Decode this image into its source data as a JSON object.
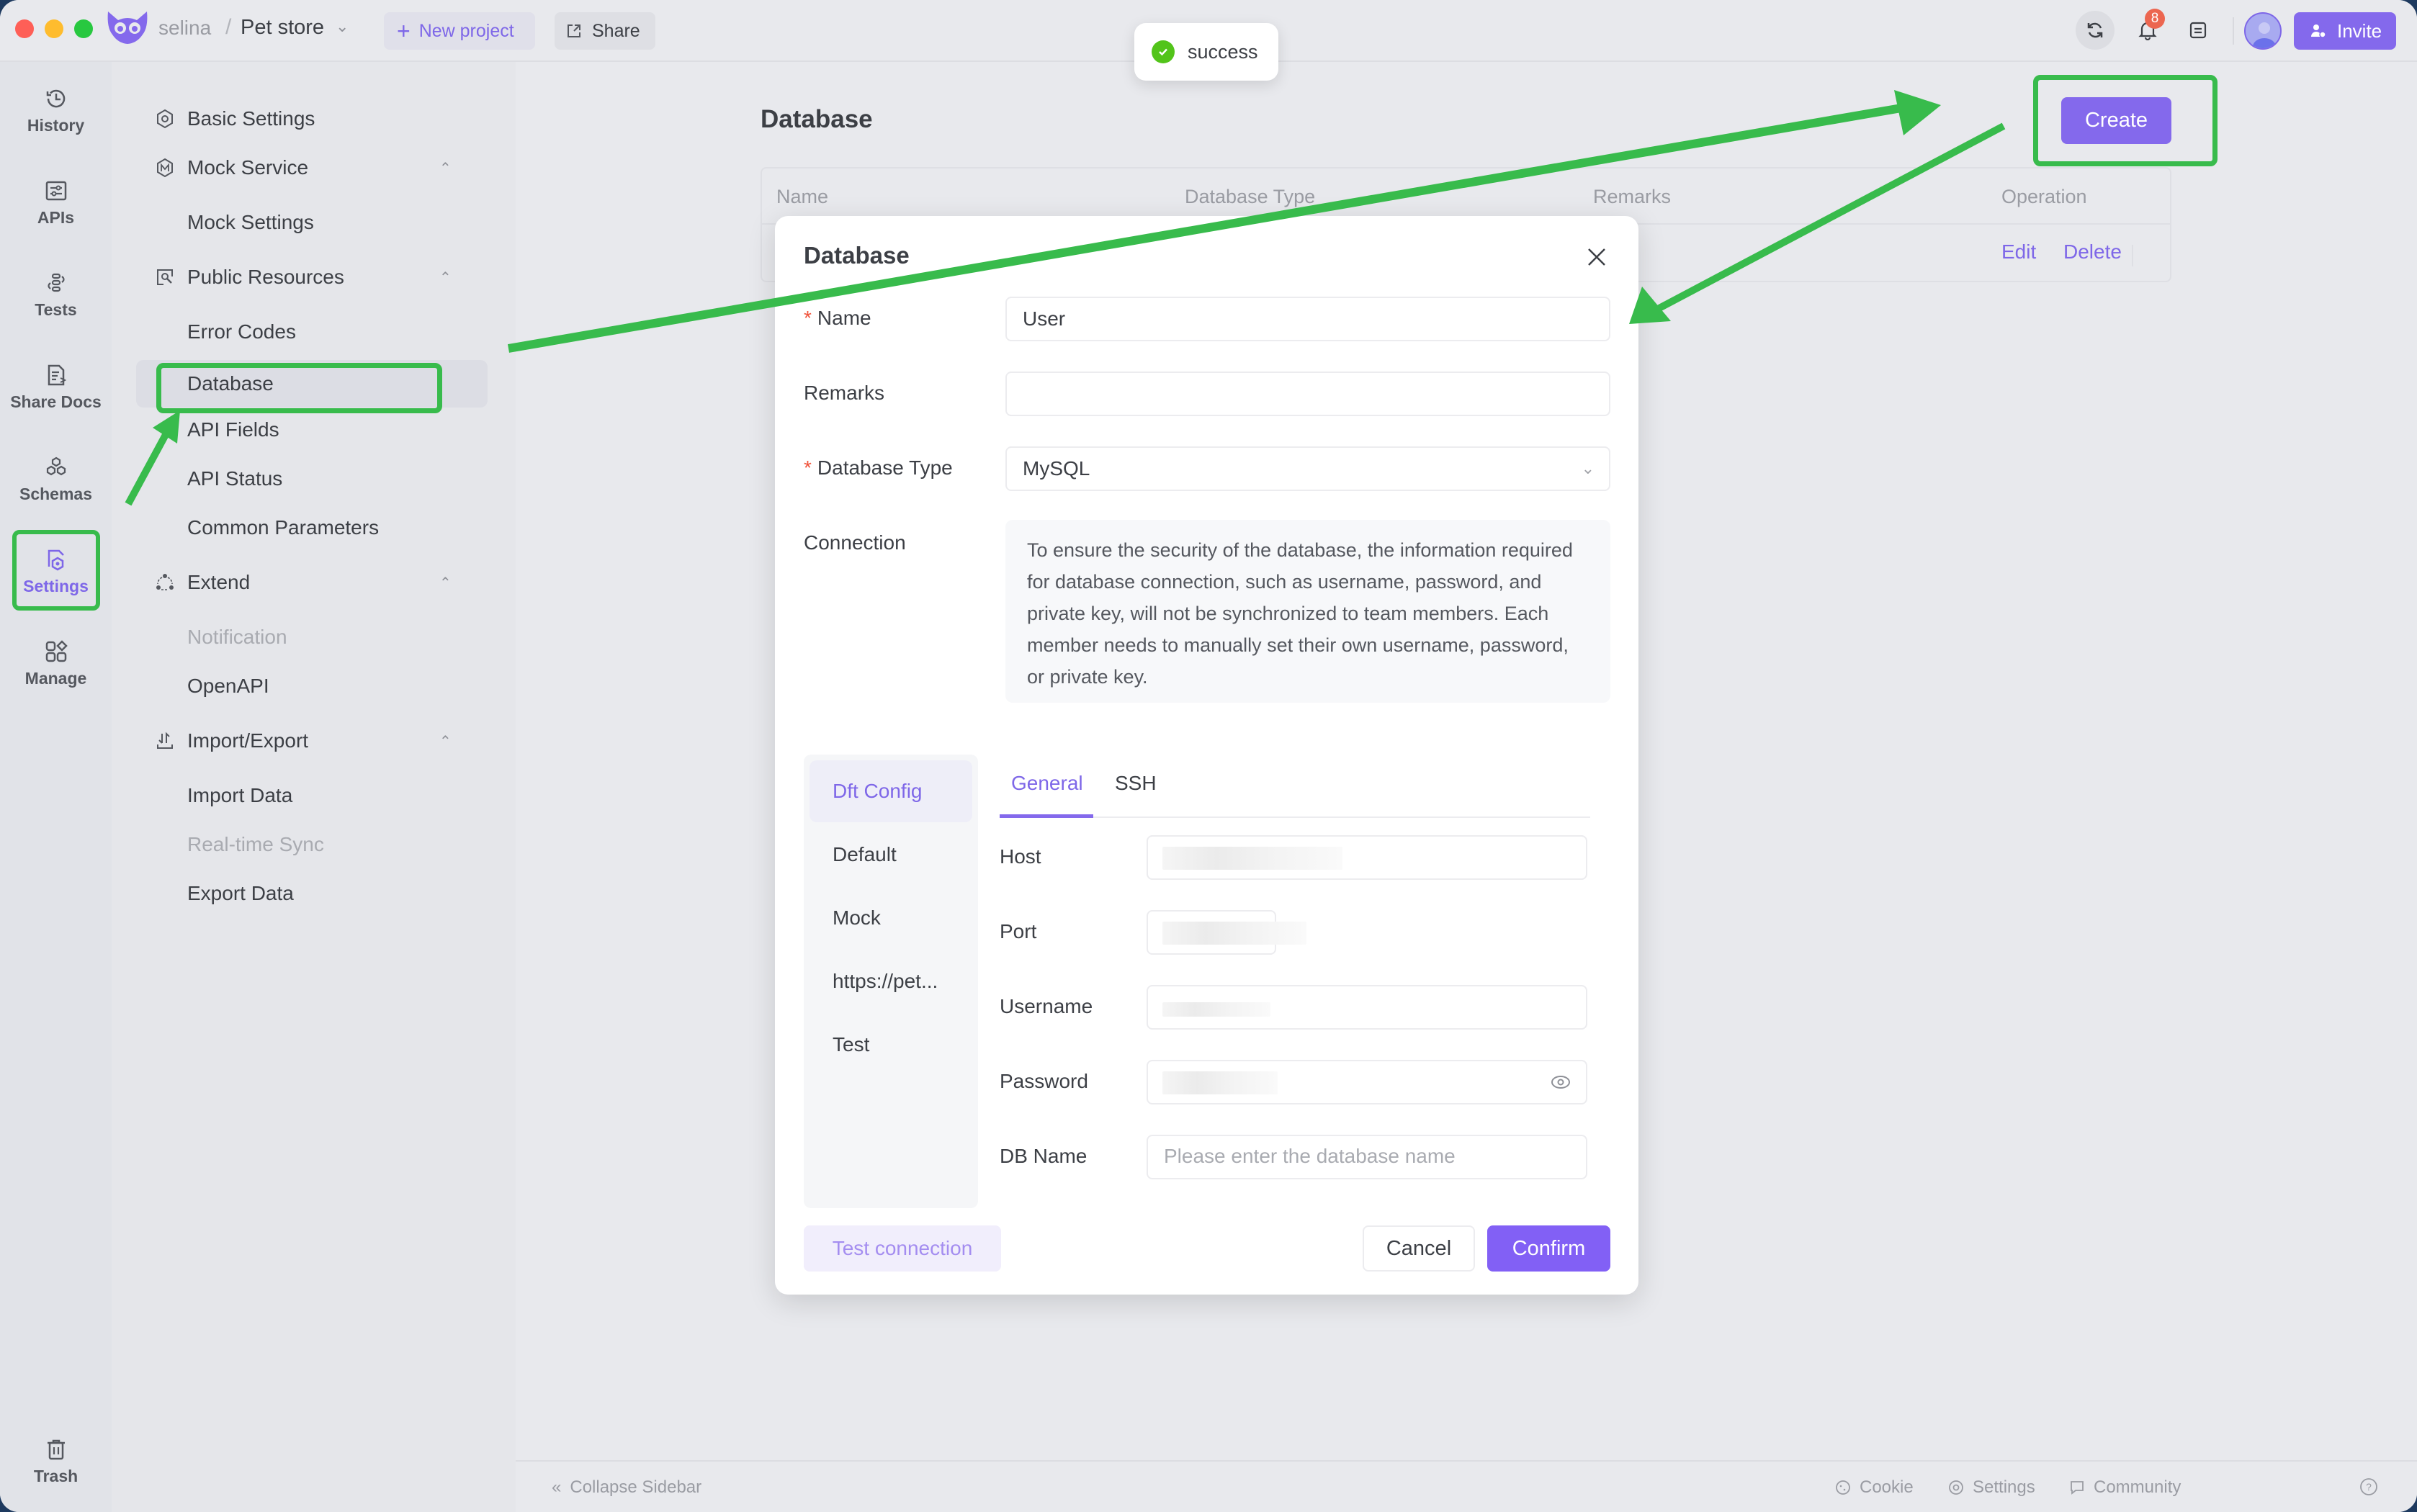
{
  "titlebar": {
    "workspace": "selina",
    "separator": "/",
    "project": "Pet store",
    "new_project_label": "New project",
    "share_label": "Share",
    "notification_count": "8",
    "invite_label": "Invite"
  },
  "rail": {
    "items": [
      {
        "label": "History",
        "icon": "history-icon"
      },
      {
        "label": "APIs",
        "icon": "apis-icon"
      },
      {
        "label": "Tests",
        "icon": "tests-icon"
      },
      {
        "label": "Share Docs",
        "icon": "share-docs-icon"
      },
      {
        "label": "Schemas",
        "icon": "schemas-icon"
      },
      {
        "label": "Settings",
        "icon": "settings-icon",
        "active": true
      },
      {
        "label": "Manage",
        "icon": "manage-icon"
      }
    ],
    "trash_label": "Trash"
  },
  "nav": {
    "basic_settings": "Basic Settings",
    "mock_service": "Mock Service",
    "mock_settings": "Mock Settings",
    "public_resources": "Public Resources",
    "error_codes": "Error Codes",
    "database": "Database",
    "api_fields": "API Fields",
    "api_status": "API Status",
    "common_parameters": "Common Parameters",
    "extend": "Extend",
    "notification": "Notification",
    "openapi": "OpenAPI",
    "import_export": "Import/Export",
    "import_data": "Import Data",
    "realtime_sync": "Real-time Sync",
    "export_data": "Export Data"
  },
  "main": {
    "title": "Database",
    "create_label": "Create",
    "table": {
      "headers": [
        "Name",
        "Database Type",
        "Remarks",
        "Operation"
      ],
      "row_ops": {
        "edit": "Edit",
        "delete": "Delete"
      }
    }
  },
  "toast": {
    "message": "success"
  },
  "dialog": {
    "title": "Database",
    "name_label": "Name",
    "name_value": "User",
    "remarks_label": "Remarks",
    "remarks_value": "",
    "type_label": "Database Type",
    "type_value": "MySQL",
    "connection_label": "Connection",
    "connection_notice": "To ensure the security of the database, the information required for database connection, such as username, password, and private key, will not be synchronized to team members. Each member needs to manually set their own username, password, or private key.",
    "environments": [
      "Dft Config",
      "Default",
      "Mock",
      "https://pet...",
      "Test"
    ],
    "active_environment": "Dft Config",
    "tabs": [
      "General",
      "SSH"
    ],
    "active_tab": "General",
    "host_label": "Host",
    "port_label": "Port",
    "username_label": "Username",
    "password_label": "Password",
    "dbname_label": "DB Name",
    "dbname_placeholder": "Please enter the database name",
    "test_connection_label": "Test connection",
    "cancel_label": "Cancel",
    "confirm_label": "Confirm"
  },
  "footer": {
    "collapse_label": "Collapse Sidebar",
    "cookie_label": "Cookie",
    "settings_label": "Settings",
    "community_label": "Community"
  },
  "colors": {
    "accent": "#8469ec",
    "annotation": "#38bb4c",
    "success": "#52c41a",
    "badge": "#ec6650"
  }
}
